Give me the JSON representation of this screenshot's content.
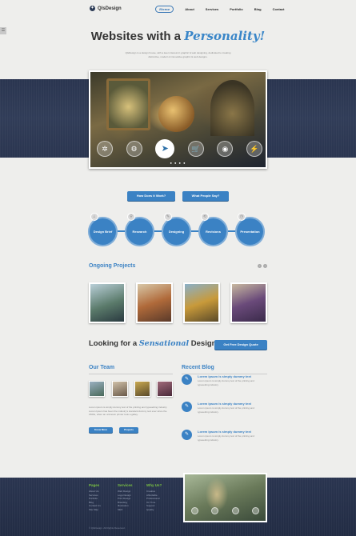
{
  "header": {
    "logo_text": "QlsDesign",
    "nav": [
      {
        "label": "Home"
      },
      {
        "label": "About"
      },
      {
        "label": "Services"
      },
      {
        "label": "Portfolio"
      },
      {
        "label": "Blog"
      },
      {
        "label": "Contact"
      }
    ]
  },
  "side_tab": "☰",
  "hero": {
    "title_prefix": "Websites with a ",
    "title_script": "Personality!",
    "subtitle": "QlsDesign is a design house, with a keen interest in graphic & web designing, dedicated to creating distinctive, modern & innovative graphic & web designs."
  },
  "slider": {
    "icons": [
      "✲",
      "⚙",
      "➤",
      "🛒",
      "◉",
      "⚡"
    ],
    "icon_names": [
      "asterisk-icon",
      "gear-icon",
      "send-icon",
      "cart-icon",
      "camera-icon",
      "lightning-icon"
    ],
    "active_index": 2,
    "dots": "● ● ● ●"
  },
  "buttons": {
    "how": "How Does it Work?",
    "people": "What People Say?"
  },
  "process": {
    "steps": [
      {
        "label": "Design Brief",
        "badge": "⌂"
      },
      {
        "label": "Research",
        "badge": "⚲"
      },
      {
        "label": "Designing",
        "badge": "✎"
      },
      {
        "label": "Revisions",
        "badge": "⟲"
      },
      {
        "label": "Presentation",
        "badge": "◷"
      }
    ]
  },
  "projects": {
    "title": "Ongoing Projects",
    "prev": "‹",
    "next": "›"
  },
  "cta": {
    "prefix": "Looking for a ",
    "script": "Sensational",
    "suffix": " Design?",
    "button": "Get Free Design Quote"
  },
  "team": {
    "title": "Our Team",
    "text": "Lorem ipsum is simply dummy text of the printing and typesetting industry. Lorem Ipsum has been the industry's standard dummy text ever since the 1500s, when an unknown printer took a galley.",
    "know_more": "Know More",
    "projects_btn": "Projects"
  },
  "blog": {
    "title": "Recent Blog",
    "posts": [
      {
        "head": "Lorem ipsum is simply dummy text",
        "body": "Lorem ipsum is simply dummy text of the printing and typesetting industry."
      },
      {
        "head": "Lorem ipsum is simply dummy text",
        "body": "Lorem ipsum is simply dummy text of the printing and typesetting industry."
      },
      {
        "head": "Lorem ipsum is simply dummy text",
        "body": "Lorem ipsum is simply dummy text of the printing and typesetting industry."
      }
    ],
    "icon": "✎"
  },
  "footer": {
    "columns": [
      {
        "head": "Pages",
        "links": [
          "About Us",
          "Services",
          "Portfolio",
          "Blog",
          "Contact Us",
          "Site Map"
        ]
      },
      {
        "head": "Services",
        "links": [
          "Web Design",
          "Logo Design",
          "Print Design",
          "Branding",
          "Illustration",
          "SEO"
        ]
      },
      {
        "head": "Why Us?",
        "links": [
          "Creative",
          "Affordable",
          "Professional",
          "On Time",
          "Support",
          "Quality"
        ]
      }
    ],
    "copyright": "© QlsDesign. All Rights Reserved."
  },
  "colors": {
    "accent": "#3b82c4",
    "band": "#2a3550",
    "footer_heading": "#7ac142"
  }
}
